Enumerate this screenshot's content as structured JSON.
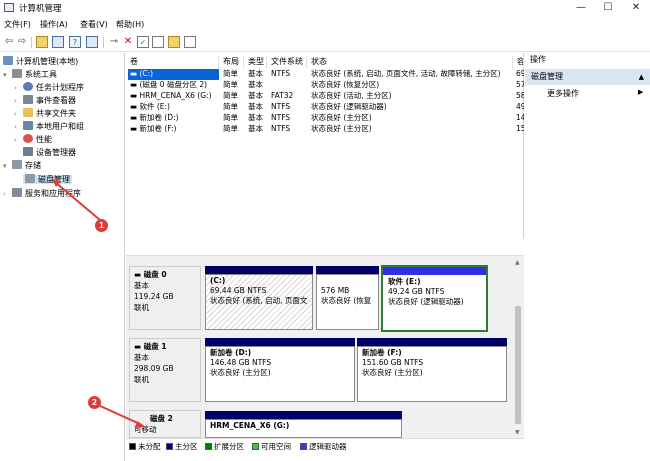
{
  "window": {
    "title": "计算机管理",
    "minimize": "—",
    "maximize": "☐",
    "close": "✕"
  },
  "menu": [
    "文件(F)",
    "操作(A)",
    "查看(V)",
    "帮助(H)"
  ],
  "tree": {
    "root": "计算机管理(本地)",
    "system_tools": "系统工具",
    "items": [
      "任务计划程序",
      "事件查看器",
      "共享文件夹",
      "本地用户和组",
      "性能",
      "设备管理器"
    ],
    "storage": "存储",
    "disk_mgmt": "磁盘管理",
    "services": "服务和应用程序"
  },
  "volume_list": {
    "headers": [
      "卷",
      "布局",
      "类型",
      "文件系统",
      "状态",
      "容"
    ],
    "rows": [
      [
        "(C:)",
        "简单",
        "基本",
        "NTFS",
        "状态良好 (系统, 启动, 页面文件, 活动, 故障转储, 主分区)",
        "69"
      ],
      [
        "(磁盘 0 磁盘分区 2)",
        "简单",
        "基本",
        "",
        "状态良好 (恢复分区)",
        "57"
      ],
      [
        "HRM_CENA_X6 (G:)",
        "简单",
        "基本",
        "FAT32",
        "状态良好 (活动, 主分区)",
        "58"
      ],
      [
        "软件 (E:)",
        "简单",
        "基本",
        "NTFS",
        "状态良好 (逻辑驱动器)",
        "49"
      ],
      [
        "新加卷 (D:)",
        "简单",
        "基本",
        "NTFS",
        "状态良好 (主分区)",
        "14"
      ],
      [
        "新加卷 (F:)",
        "简单",
        "基本",
        "NTFS",
        "状态良好 (主分区)",
        "15"
      ]
    ]
  },
  "disks": [
    {
      "name": "磁盘 0",
      "type": "基本",
      "size": "119.24 GB",
      "status": "联机",
      "partitions": [
        {
          "name": "(C:)",
          "size": "69.44 GB NTFS",
          "status": "状态良好 (系统, 启动, 页面文"
        },
        {
          "name": "",
          "size": "576 MB",
          "status": "状态良好 (恢复"
        },
        {
          "name": "软件  (E:)",
          "size": "49.24 GB NTFS",
          "status": "状态良好 (逻辑驱动器)"
        }
      ]
    },
    {
      "name": "磁盘 1",
      "type": "基本",
      "size": "298.09 GB",
      "status": "联机",
      "partitions": [
        {
          "name": "新加卷  (D:)",
          "size": "146.48 GB NTFS",
          "status": "状态良好 (主分区)"
        },
        {
          "name": "新加卷  (F:)",
          "size": "151.60 GB NTFS",
          "status": "状态良好 (主分区)"
        }
      ]
    },
    {
      "name": "磁盘 2",
      "type": "可移动",
      "partitions": [
        {
          "name": "HRM_CENA_X6  (G:)"
        }
      ]
    }
  ],
  "legend": [
    {
      "label": "未分配",
      "color": "#000000"
    },
    {
      "label": "主分区",
      "color": "#000080"
    },
    {
      "label": "扩展分区",
      "color": "#008000"
    },
    {
      "label": "可用空间",
      "color": "#33cc33"
    },
    {
      "label": "逻辑驱动器",
      "color": "#3333ff"
    }
  ],
  "actions": {
    "header": "操作",
    "section": "磁盘管理",
    "more": "更多操作",
    "section_arrow": "▲",
    "more_arrow": "▶"
  },
  "annotations": [
    "1",
    "2"
  ],
  "colors": {
    "accent_red": "#e03a3a",
    "primary_partition": "#000066",
    "logical_drive": "#2f2fe6",
    "selection": "#cce4f7"
  }
}
